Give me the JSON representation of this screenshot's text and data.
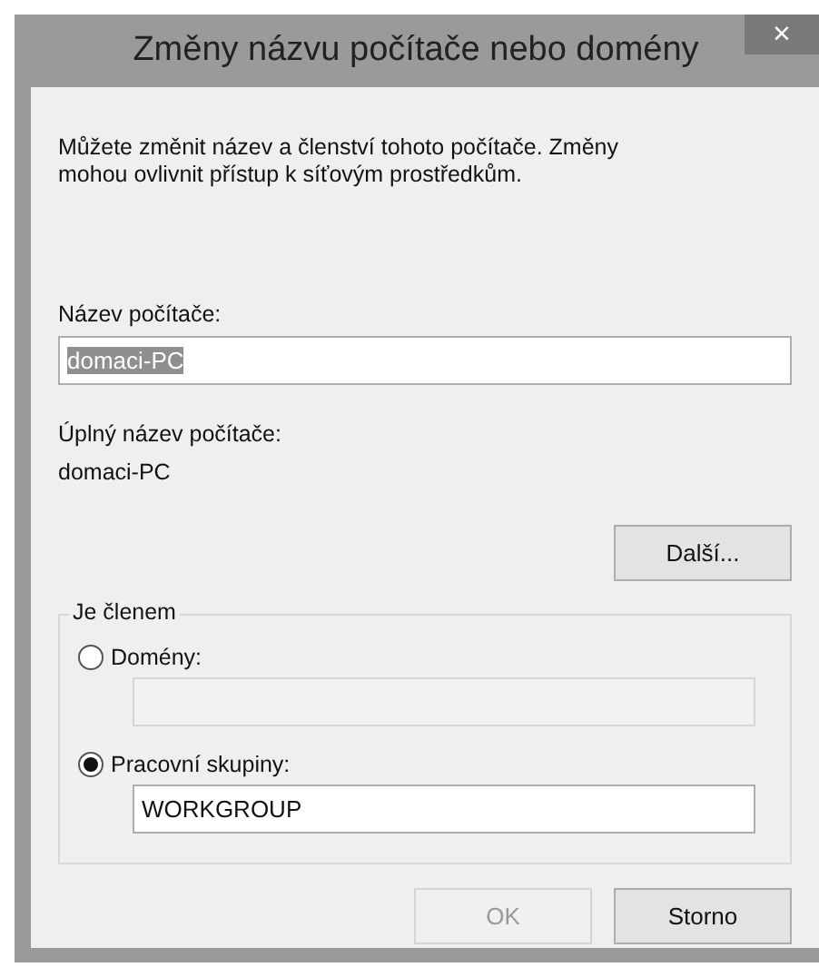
{
  "window": {
    "title": "Změny názvu počítače nebo domény",
    "close": "×"
  },
  "description": "Můžete změnit název a členství tohoto počítače. Změny mohou ovlivnit přístup k síťovým prostředkům.",
  "computer_name": {
    "label": "Název počítače:",
    "value": "domaci-PC",
    "text_selected": true
  },
  "full_name": {
    "label": "Úplný název počítače:",
    "value": "domaci-PC"
  },
  "more_button": {
    "label": "Další...",
    "disabled": false
  },
  "member_of": {
    "legend": "Je členem",
    "options": [
      {
        "label": "Domény:",
        "selected": false,
        "field": {
          "disabled": true
        }
      },
      {
        "label": "Pracovní skupiny:",
        "selected": true,
        "field": {
          "value": "WORKGROUP",
          "disabled": false
        }
      }
    ]
  },
  "buttons": [
    {
      "label": "OK",
      "disabled": true
    },
    {
      "label": "Storno",
      "disabled": false
    }
  ]
}
